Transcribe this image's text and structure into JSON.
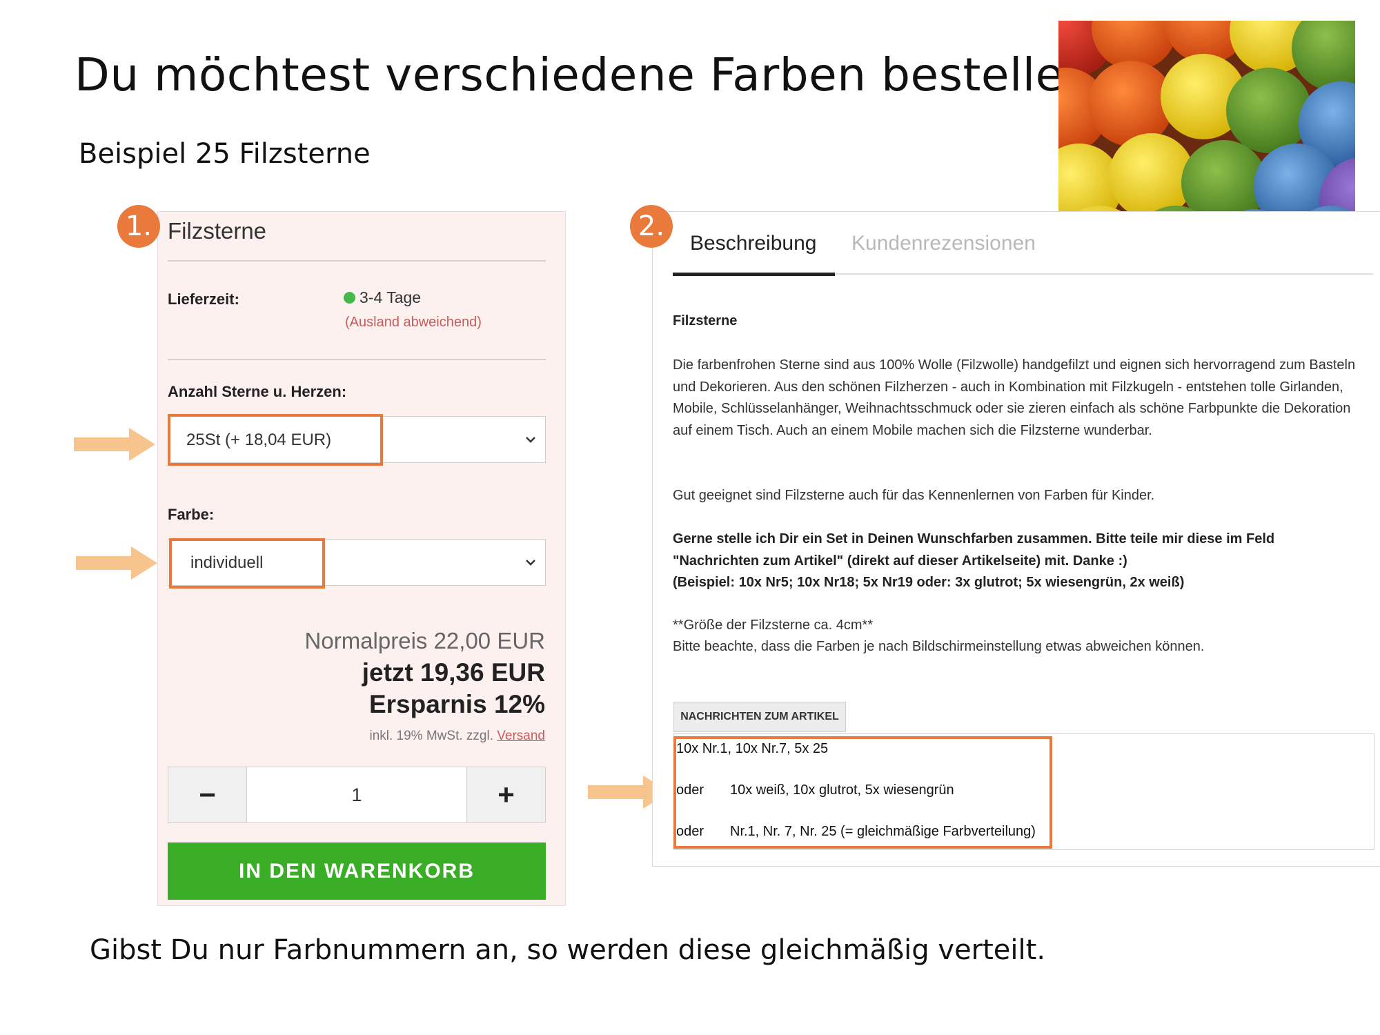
{
  "slide": {
    "title": "Du möchtest verschiedene Farben bestellen?",
    "subtitle": "Beispiel 25 Filzsterne",
    "footer": "Gibst Du nur Farbnummern an, so werden diese gleichmäßig verteilt."
  },
  "steps": {
    "one": "1.",
    "two": "2."
  },
  "product": {
    "title": "Filzsterne",
    "delivery_label": "Lieferzeit:",
    "delivery_value": "3-4 Tage",
    "delivery_note": "(Ausland abweichend)",
    "count_label": "Anzahl Sterne u. Herzen:",
    "count_selected": "25St (+ 18,04 EUR)",
    "color_label": "Farbe:",
    "color_selected": "individuell",
    "price_regular": "Normalpreis 22,00 EUR",
    "price_now": "jetzt 19,36 EUR",
    "savings": "Ersparnis 12%",
    "tax_note": "inkl. 19% MwSt. zzgl.",
    "shipping_link": "Versand",
    "minus": "−",
    "quantity": "1",
    "plus": "+",
    "cart_button": "IN DEN WARENKORB"
  },
  "description": {
    "tab_active": "Beschreibung",
    "tab_inactive": "Kundenrezensionen",
    "heading": "Filzsterne",
    "para1": "Die farbenfrohen Sterne sind aus 100% Wolle (Filzwolle) handgefilzt und eignen sich hervorragend zum Basteln und Dekorieren. Aus den schönen Filzherzen - auch in Kombination mit Filzkugeln - entstehen tolle Girlanden, Mobile, Schlüsselanhänger, Weihnachtsschmuck oder sie zieren einfach als schöne Farbpunkte die Dekoration auf einem Tisch. Auch an einem Mobile machen sich die Filzsterne wunderbar.",
    "para2": "Gut geeignet sind Filzsterne auch für das Kennenlernen von Farben für Kinder.",
    "bold1": "Gerne stelle ich Dir ein Set in Deinen Wunschfarben zusammen. Bitte teile mir diese im Feld \"Nachrichten zum Artikel\" (direkt auf dieser Artikelseite) mit. Danke :)",
    "bold2": "(Beispiel: 10x Nr5; 10x Nr18; 5x Nr19 oder: 3x glutrot; 5x wiesengrün, 2x weiß)",
    "size": "**Größe der Filzsterne ca. 4cm**",
    "note": "Bitte beachte, dass die Farben je nach Bildschirmeinstellung etwas abweichen können.",
    "message_label": "NACHRICHTEN ZUM ARTIKEL",
    "message_line1": "10x Nr.1, 10x Nr.7, 5x 25",
    "message_or1": "oder",
    "message_line2": "10x weiß, 10x glutrot, 5x wiesengrün",
    "message_or2": "oder",
    "message_line3": "Nr.1, Nr. 7, Nr. 25 (= gleichmäßige Farbverteilung)"
  },
  "colors": {
    "accent": "#ea7a3c",
    "arrow": "#f8c48e",
    "cart_green": "#3aad26",
    "panel_bg": "#fdf1f0"
  }
}
